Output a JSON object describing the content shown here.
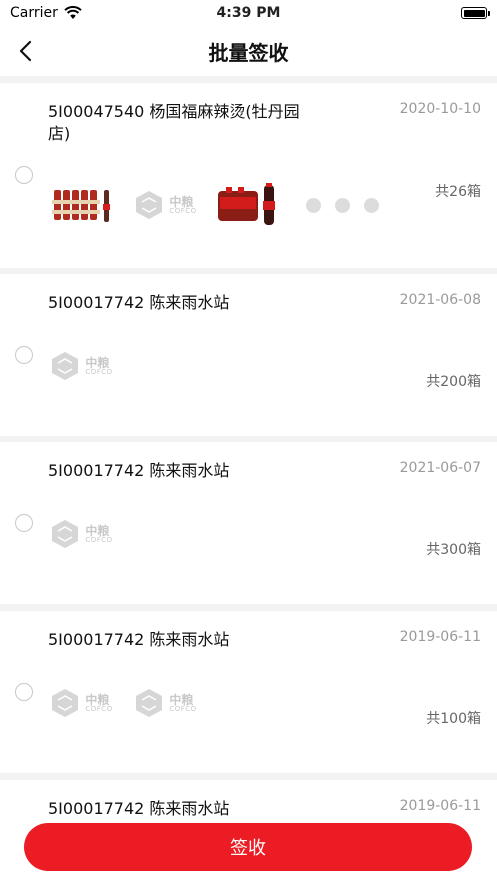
{
  "status_bar": {
    "carrier": "Carrier",
    "time": "4:39 PM"
  },
  "nav": {
    "title": "批量签收"
  },
  "orders": [
    {
      "title": "5I00047540 杨国福麻辣烫(牡丹园店)",
      "date": "2020-10-10",
      "count": "共26箱",
      "thumbs": [
        "coke-crate",
        "cofco-logo",
        "coke-pack",
        "coke-bottle"
      ],
      "more": true
    },
    {
      "title": "5I00017742 陈来雨水站",
      "date": "2021-06-08",
      "count": "共200箱",
      "thumbs": [
        "cofco-logo"
      ],
      "more": false
    },
    {
      "title": "5I00017742 陈来雨水站",
      "date": "2021-06-07",
      "count": "共300箱",
      "thumbs": [
        "cofco-logo"
      ],
      "more": false
    },
    {
      "title": "5I00017742 陈来雨水站",
      "date": "2019-06-11",
      "count": "共100箱",
      "thumbs": [
        "cofco-logo",
        "cofco-logo"
      ],
      "more": false
    },
    {
      "title": "5I00017742 陈来雨水站",
      "date": "2019-06-11",
      "count": "",
      "thumbs": [],
      "more": false
    }
  ],
  "logo_text": {
    "cn": "中粮",
    "en": "COFCO"
  },
  "action": {
    "sign_label": "签收"
  },
  "colors": {
    "accent": "#ec1c24",
    "background": "#f2f2f2"
  }
}
